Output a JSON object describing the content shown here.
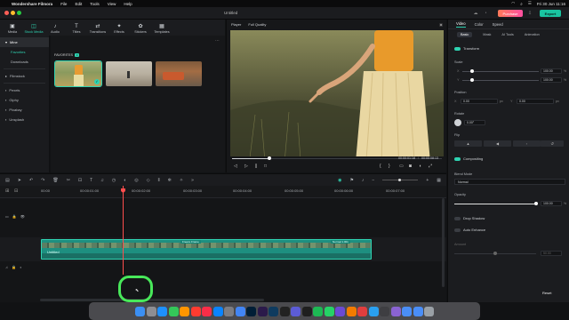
{
  "menubar": {
    "app_name": "Wondershare Filmora",
    "menus": [
      "File",
      "Edit",
      "Tools",
      "View",
      "Help"
    ],
    "clock": "Fri 30 Jun 11:16"
  },
  "titlebar": {
    "doc_title": "Untitled",
    "purchase_label": "Purchase",
    "export_label": "Export"
  },
  "media_toolbar": {
    "tools": [
      {
        "label": "Media",
        "icon": "media-icon"
      },
      {
        "label": "Stock Media",
        "icon": "stock-media-icon"
      },
      {
        "label": "Audio",
        "icon": "audio-icon"
      },
      {
        "label": "Titles",
        "icon": "titles-icon"
      },
      {
        "label": "Transitions",
        "icon": "transitions-icon"
      },
      {
        "label": "Effects",
        "icon": "effects-icon"
      },
      {
        "label": "Stickers",
        "icon": "stickers-icon"
      },
      {
        "label": "Templates",
        "icon": "templates-icon"
      }
    ],
    "active_index": 1
  },
  "sidebar": {
    "items": [
      {
        "label": "Mine"
      },
      {
        "label": "Favorites"
      },
      {
        "label": "Downloads"
      },
      {
        "label": "Filmstock"
      },
      {
        "label": "Pexels"
      },
      {
        "label": "Giphy"
      },
      {
        "label": "Pixabay"
      },
      {
        "label": "Unsplash"
      }
    ]
  },
  "media": {
    "section_label": "FAVORITES",
    "favorites_count": "3"
  },
  "player": {
    "label": "Player",
    "quality": "Full Quality",
    "current_time": "00:00:01:18",
    "total_time": "00:00:08:13",
    "progress": 0.18
  },
  "props": {
    "tabs": [
      "Video",
      "Color",
      "Speed"
    ],
    "subtabs": [
      "Basic",
      "Mask",
      "AI Tools",
      "Animation"
    ],
    "transform_label": "Transform",
    "scale_label": "Scale",
    "scale_x": "100.00",
    "scale_y": "100.00",
    "percent": "%",
    "position_label": "Position",
    "pos_x": "0.00",
    "pos_y": "0.00",
    "px": "px",
    "rotate_label": "Rotate",
    "rotate_value": "0.00°",
    "flip_label": "Flip",
    "compositing_label": "Compositing",
    "blend_label": "Blend Mode",
    "blend_value": "Normal",
    "opacity_label": "Opacity",
    "opacity_value": "100.00",
    "opacity_level": 1.0,
    "drop_shadow_label": "Drop Shadow",
    "auto_enhance_label": "Auto Enhance",
    "amount_label": "Amount",
    "amount_value": "50.00",
    "reset_label": "Reset"
  },
  "timeline": {
    "ticks": [
      "00:00",
      "00:00:01:00",
      "00:00:02:00",
      "00:00:03:00",
      "00:00:04:00",
      "00:00:05:00",
      "00:00:06:00",
      "00:00:07:00"
    ],
    "clip_name": "Untitled",
    "clip_fx_left": "Freeze Frame",
    "clip_fx_right": "Normal 1.00x"
  },
  "colors": {
    "accent": "#2fd3b2",
    "playhead": "#ff4d4d",
    "highlight": "#48e85a"
  }
}
